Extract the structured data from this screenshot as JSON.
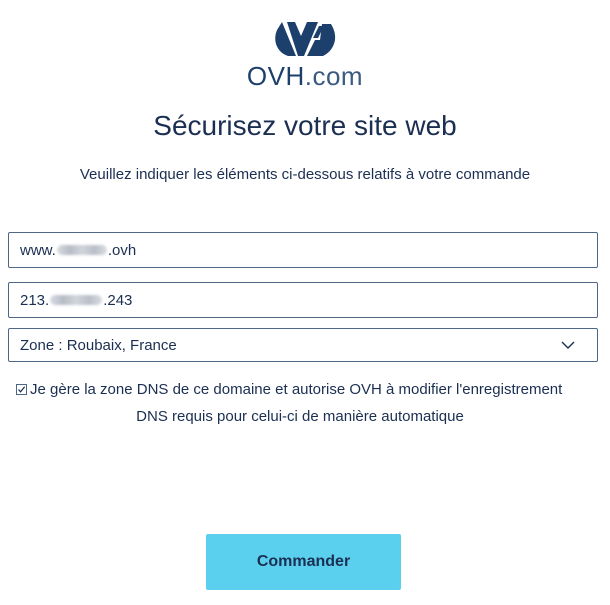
{
  "logo": {
    "icon": "ovh-logo-mark",
    "brand": "OVH",
    "tld": ".com",
    "color": "#1d3f6b"
  },
  "header": {
    "title": "Sécurisez votre site web",
    "subtitle": "Veuillez indiquer les éléments ci-dessous relatifs à votre commande"
  },
  "form": {
    "domain": {
      "prefix": "www.",
      "suffix": ".ovh",
      "redacted": true
    },
    "ip": {
      "prefix": "213.",
      "suffix": ".243",
      "redacted": true
    },
    "zone": {
      "selected": "Zone : Roubaix, France",
      "icon": "chevron-down-icon"
    },
    "consent": {
      "checked": true,
      "line1": "Je gère la zone DNS de ce domaine et autorise OVH à modifier l'enregistrement",
      "line2": "DNS requis pour celui-ci de manière automatique"
    },
    "submit_label": "Commander"
  },
  "colors": {
    "text": "#1b2f52",
    "border": "#4f6787",
    "button": "#5bd0ee"
  }
}
